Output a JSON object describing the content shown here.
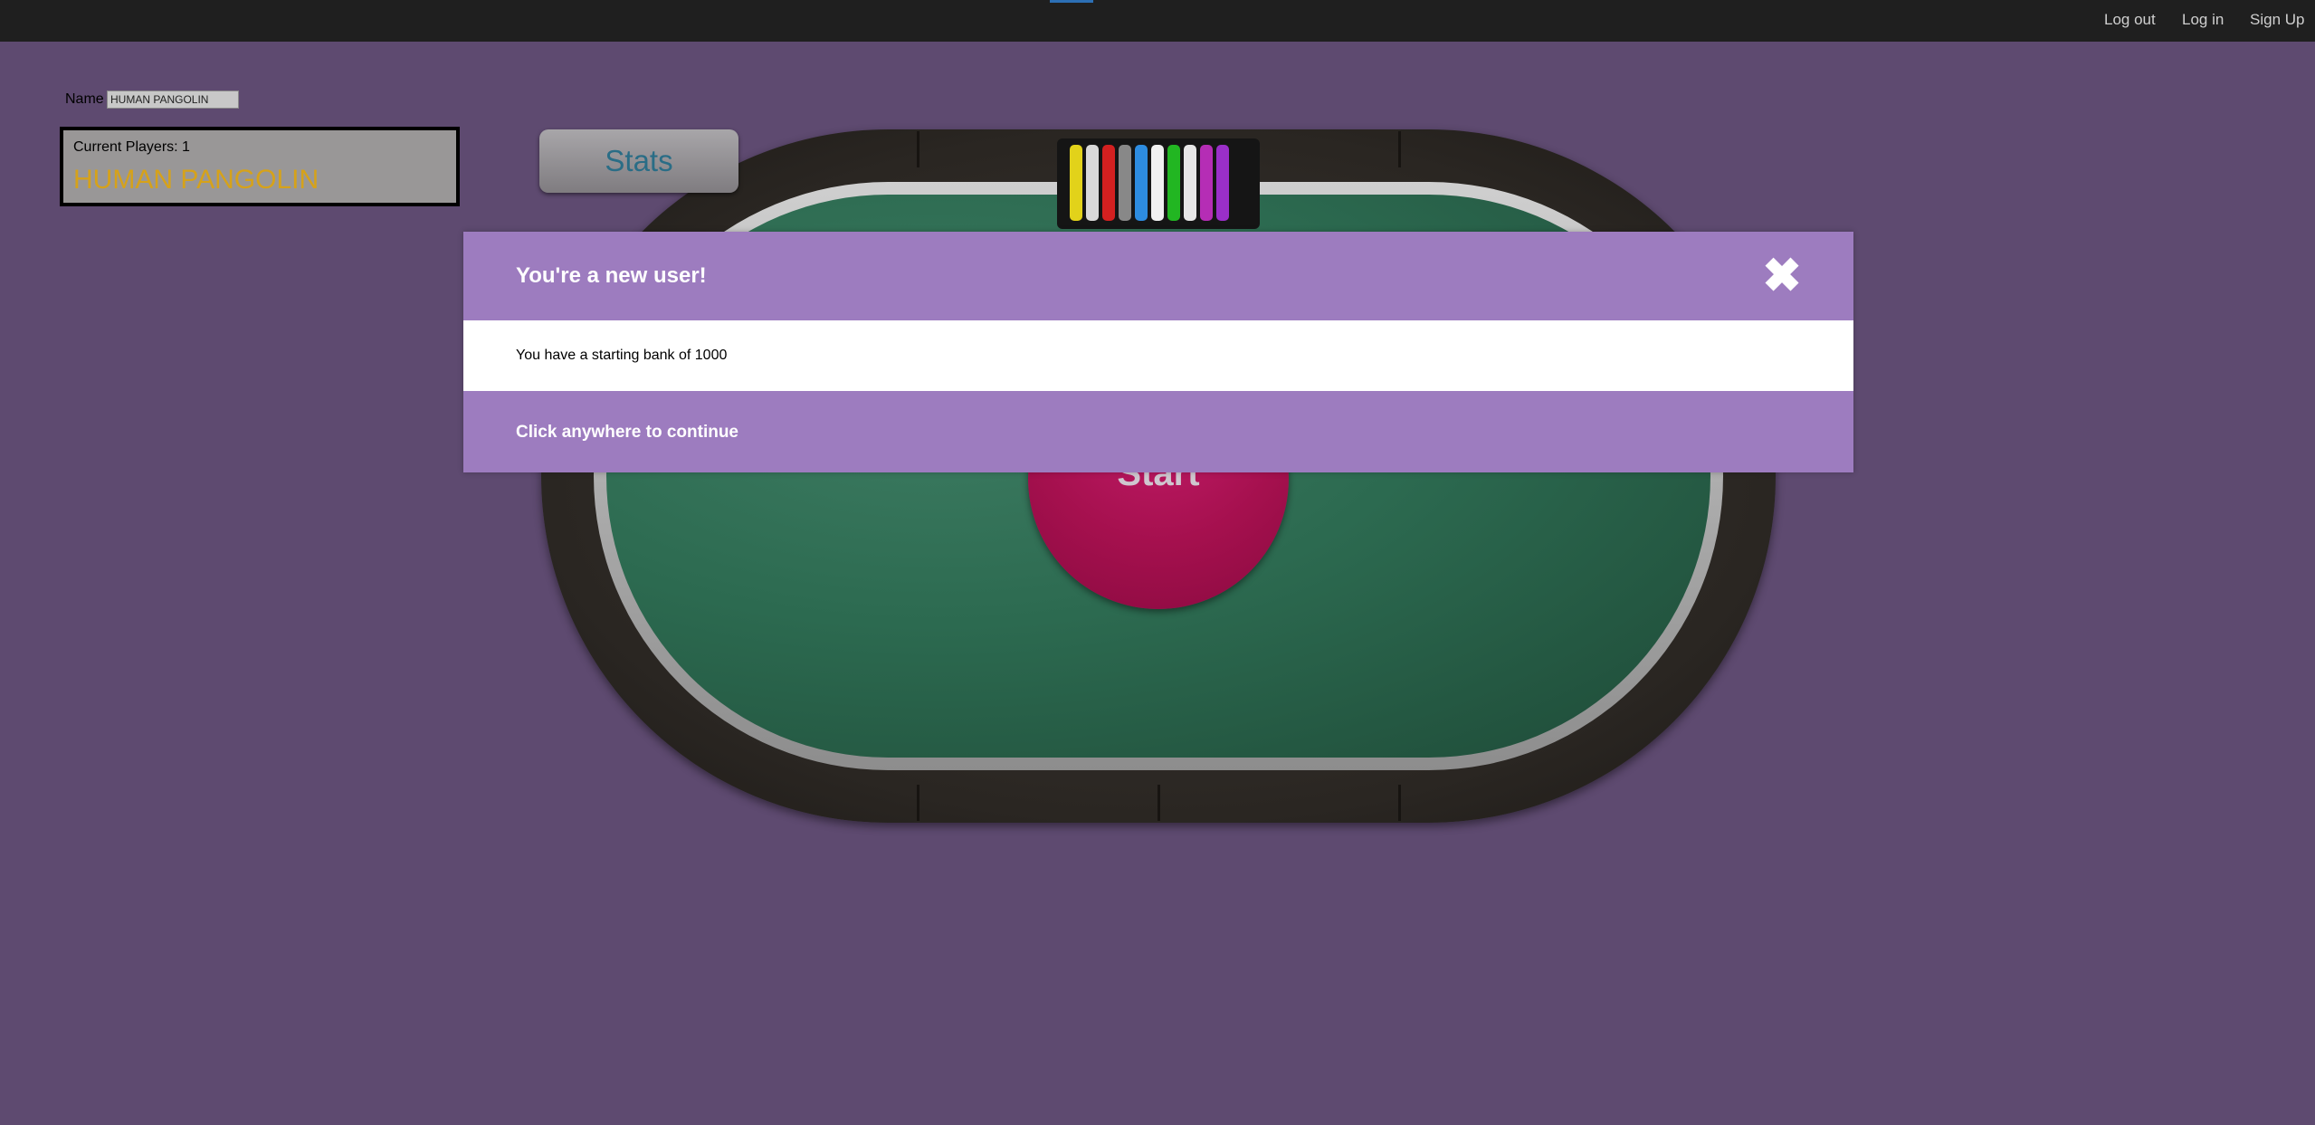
{
  "topbar": {
    "links": [
      "Log out",
      "Log in",
      "Sign Up"
    ]
  },
  "name_field": {
    "label": "Name",
    "value": "HUMAN PANGOLIN"
  },
  "players": {
    "count_text": "Current Players: 1",
    "names": [
      "HUMAN PANGOLIN"
    ]
  },
  "stats_button": "Stats",
  "start_button": "Start",
  "chip_rack": {
    "colors": [
      "#e2d21a",
      "#d9d9d9",
      "#d32020",
      "#888888",
      "#2d8ce0",
      "#f0f0f0",
      "#22b622",
      "#e6e6e6",
      "#b52db5",
      "#9a2fc9"
    ]
  },
  "modal": {
    "title": "You're a new user!",
    "body": "You have a starting bank of 1000",
    "footer": "Click anywhere to continue",
    "close_icon": "close-icon"
  },
  "colors": {
    "background": "#5e4a70",
    "modal_header": "#9d7cbf",
    "player_name": "#d6a21a",
    "start_button": "#a5104e"
  }
}
